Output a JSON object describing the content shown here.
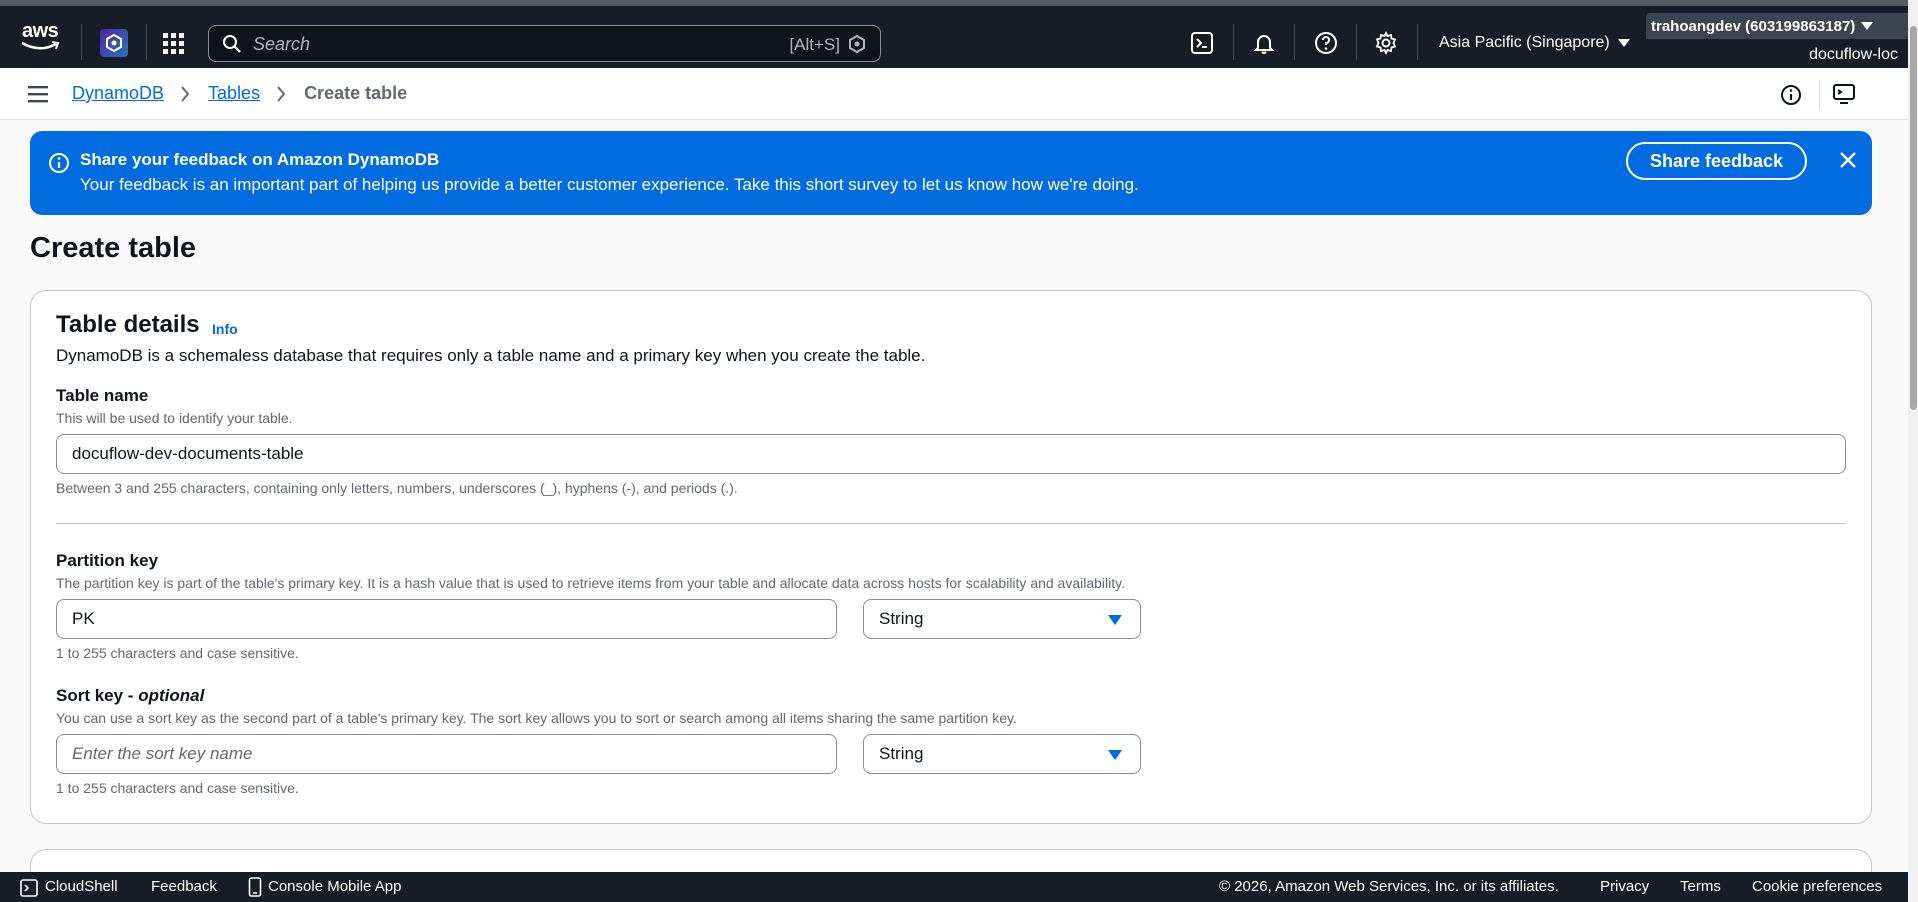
{
  "topnav": {
    "logo_text": "aws",
    "search_placeholder": "Search",
    "search_shortcut": "[Alt+S]",
    "region": "Asia Pacific (Singapore)",
    "account": "trahoangdev (603199863187)",
    "account_sub": "docuflow-loc"
  },
  "breadcrumb": {
    "items": [
      "DynamoDB",
      "Tables"
    ],
    "current": "Create table"
  },
  "banner": {
    "title": "Share your feedback on Amazon DynamoDB",
    "body": "Your feedback is an important part of helping us provide a better customer experience. Take this short survey to let us know how we're doing.",
    "button": "Share feedback"
  },
  "page": {
    "title": "Create table"
  },
  "table_details": {
    "title": "Table details",
    "info": "Info",
    "description": "DynamoDB is a schemaless database that requires only a table name and a primary key when you create the table.",
    "table_name": {
      "label": "Table name",
      "description": "This will be used to identify your table.",
      "value": "docuflow-dev-documents-table",
      "constraint": "Between 3 and 255 characters, containing only letters, numbers, underscores (_), hyphens (-), and periods (.)."
    },
    "partition_key": {
      "label": "Partition key",
      "description": "The partition key is part of the table's primary key. It is a hash value that is used to retrieve items from your table and allocate data across hosts for scalability and availability.",
      "value": "PK",
      "type": "String",
      "constraint": "1 to 255 characters and case sensitive."
    },
    "sort_key": {
      "label": "Sort key - ",
      "label_optional": "optional",
      "description": "You can use a sort key as the second part of a table's primary key. The sort key allows you to sort or search among all items sharing the same partition key.",
      "placeholder": "Enter the sort key name",
      "type": "String",
      "constraint": "1 to 255 characters and case sensitive."
    }
  },
  "footer": {
    "cloudshell": "CloudShell",
    "feedback": "Feedback",
    "mobile_app": "Console Mobile App",
    "copyright": "© 2026, Amazon Web Services, Inc. or its affiliates.",
    "privacy": "Privacy",
    "terms": "Terms",
    "cookies": "Cookie preferences"
  },
  "colors": {
    "nav_bg": "#161d26",
    "accent": "#006ce0",
    "page_bg": "#fafafa"
  },
  "icons": [
    "aws-logo",
    "dynamodb-service-icon",
    "apps-grid-icon",
    "search-icon",
    "amazon-q-icon",
    "cloudshell-icon",
    "bell-icon",
    "help-icon",
    "gear-icon",
    "menu-icon",
    "info-icon",
    "monitor-icon",
    "close-icon",
    "caret-down-icon",
    "mobile-icon"
  ]
}
